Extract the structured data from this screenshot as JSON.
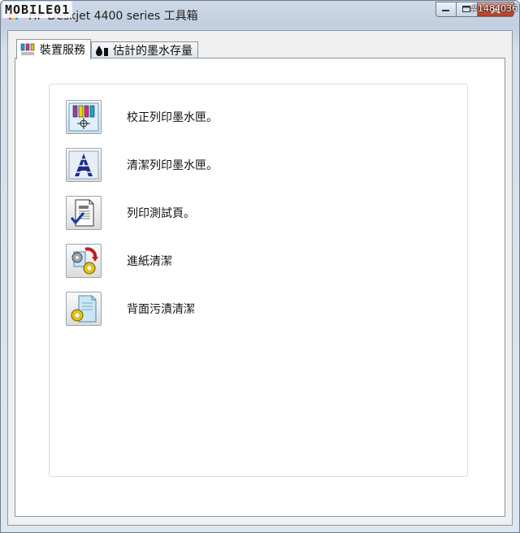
{
  "window": {
    "title": "HP Deskjet 4400 series 工具箱",
    "watermark_left": "MOBILE01",
    "watermark_right": "#1484036"
  },
  "tabs": [
    {
      "label": "裝置服務",
      "icon": "printer-cartridges-icon",
      "active": true
    },
    {
      "label": "估計的墨水存量",
      "icon": "ink-drop-icon",
      "active": false
    }
  ],
  "actions": [
    {
      "label": "校正列印墨水匣。",
      "icon": "align-cartridges-icon"
    },
    {
      "label": "清潔列印墨水匣。",
      "icon": "clean-cartridges-icon"
    },
    {
      "label": "列印測試頁。",
      "icon": "test-page-icon"
    },
    {
      "label": "進紙清潔",
      "icon": "paper-feed-clean-icon"
    },
    {
      "label": "背面污漬清潔",
      "icon": "back-smudge-clean-icon"
    }
  ]
}
